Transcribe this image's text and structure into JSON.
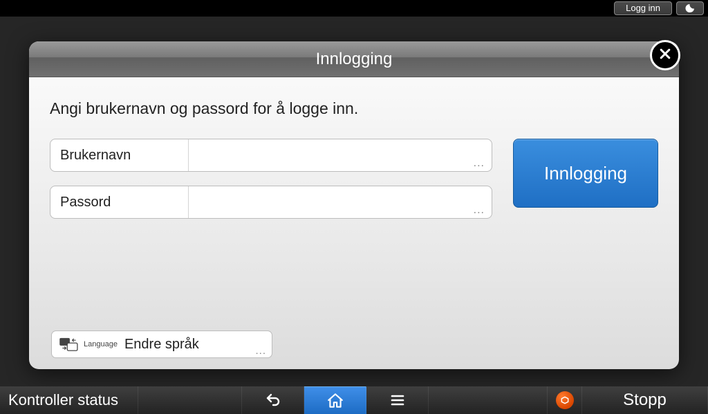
{
  "statusbar": {
    "login_label": "Logg inn"
  },
  "dialog": {
    "title": "Innlogging",
    "instruction": "Angi brukernavn og passord for å logge inn.",
    "username_label": "Brukernavn",
    "username_value": "",
    "password_label": "Passord",
    "password_value": "",
    "submit_label": "Innlogging",
    "language_small": "Language",
    "language_label": "Endre språk"
  },
  "bottombar": {
    "status_label": "Kontroller status",
    "stop_label": "Stopp"
  }
}
